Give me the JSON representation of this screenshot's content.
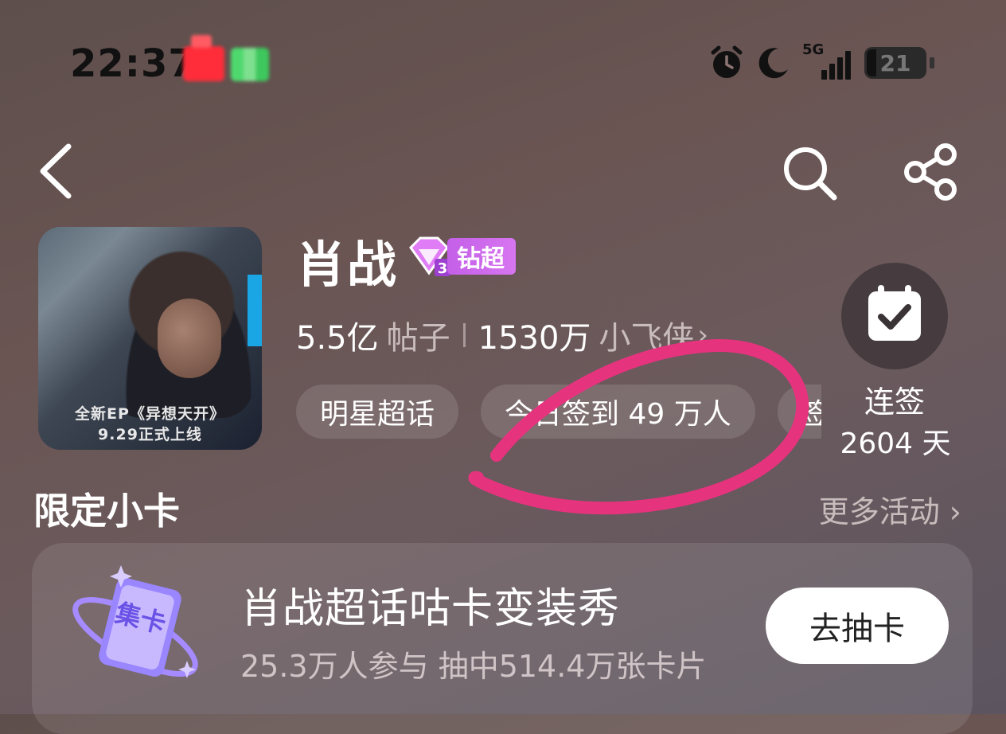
{
  "status_bar": {
    "time": "22:37",
    "network": "5G",
    "battery": "21"
  },
  "nav": {
    "back_icon": "chevron-left-icon",
    "search_icon": "search-icon",
    "share_icon": "share-icon"
  },
  "header": {
    "avatar_caption_1": "全新EP《异想天开》",
    "avatar_caption_2": "9.29正式上线",
    "name": "肖战",
    "badge_label": "钻超",
    "posts_count": "5.5亿",
    "posts_unit": "帖子",
    "fans_count": "1530万",
    "fans_unit": "小飞侠",
    "chevron": "›",
    "chips": [
      "明星超话",
      "今日签到 49 万人",
      "签"
    ]
  },
  "checkin": {
    "icon": "calendar-check-icon",
    "label": "连签",
    "days": "2604 天"
  },
  "section": {
    "title": "限定小卡",
    "more": "更多活动 ›"
  },
  "card": {
    "icon_text": "集卡",
    "title": "肖战超话咕卡变装秀",
    "subtitle": "25.3万人参与 抽中514.4万张卡片",
    "button": "去抽卡"
  },
  "colors": {
    "badge": "#c45fe8",
    "annotation": "#e6337e",
    "background": "#65534f"
  }
}
